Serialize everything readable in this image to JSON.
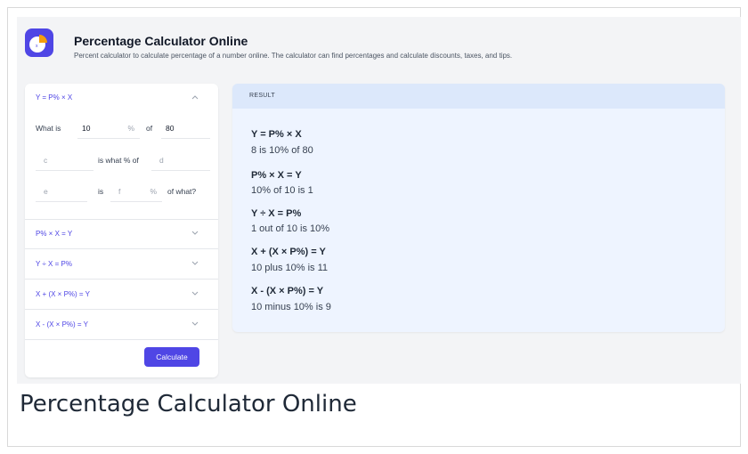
{
  "header": {
    "title": "Percentage Calculator Online",
    "subtitle": "Percent calculator to calculate percentage of a number online. The calculator can find percentages and calculate discounts, taxes, and tips."
  },
  "left": {
    "sections": [
      {
        "label": "Y = P% × X",
        "expanded": true
      },
      {
        "label": "P% × X = Y",
        "expanded": false
      },
      {
        "label": "Y ÷ X = P%",
        "expanded": false
      },
      {
        "label": "X + (X × P%) = Y",
        "expanded": false
      },
      {
        "label": "X - (X × P%) = Y",
        "expanded": false
      }
    ],
    "form": {
      "row1": {
        "prefix": "What is",
        "p_value": "10",
        "pct": "%",
        "of": "of",
        "x_value": "80"
      },
      "row2": {
        "c_placeholder": "c",
        "middle": "is what % of",
        "d_placeholder": "d"
      },
      "row3": {
        "e_placeholder": "e",
        "is": "is",
        "f_placeholder": "f",
        "pct": "%",
        "suffix": "of what?"
      }
    },
    "calculate_label": "Calculate"
  },
  "result": {
    "header": "RESULT",
    "items": [
      {
        "title": "Y = P% × X",
        "text": "8 is 10% of 80"
      },
      {
        "title": "P% × X = Y",
        "text": "10% of 10 is 1"
      },
      {
        "title": "Y ÷ X = P%",
        "text": "1 out of 10 is 10%"
      },
      {
        "title": "X + (X × P%) = Y",
        "text": "10 plus 10% is 11"
      },
      {
        "title": "X - (X × P%) = Y",
        "text": "10 minus 10% is 9"
      }
    ]
  },
  "page_heading": "Percentage Calculator Online",
  "colors": {
    "accent": "#4f46e5",
    "result_bg": "#eef4ff",
    "result_header_bg": "#dce8fb"
  }
}
